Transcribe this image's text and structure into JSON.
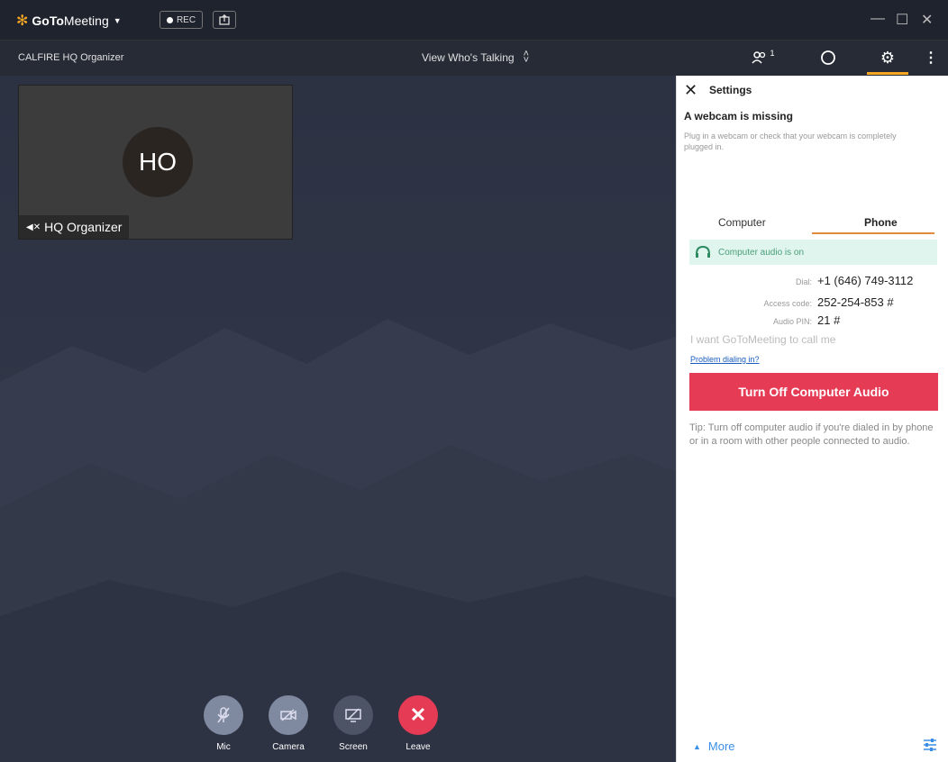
{
  "app": {
    "logo_bold": "GoTo",
    "logo_rest": "Meeting",
    "rec_label": "REC",
    "meeting_title": "CALFIRE HQ Organizer",
    "view_mode": "View Who's Talking",
    "attendee_count": "1"
  },
  "tile": {
    "initials": "HO",
    "name": "HQ Organizer"
  },
  "controls": [
    {
      "label": "Mic"
    },
    {
      "label": "Camera"
    },
    {
      "label": "Screen"
    },
    {
      "label": "Leave"
    }
  ],
  "panel": {
    "title": "Settings",
    "warning_title": "A webcam is missing",
    "warning_msg": "Plug in a webcam or check that your webcam is completely plugged in.",
    "tabs": [
      {
        "label": "Computer",
        "active": false
      },
      {
        "label": "Phone",
        "active": true
      }
    ],
    "audio_status": "Computer audio is on",
    "dial_label": "Dial:",
    "dial_value": "+1 (646) 749-3112",
    "access_label": "Access code:",
    "access_value": "252-254-853 #",
    "pin_label": "Audio PIN:",
    "pin_value": "21 #",
    "call_me": "I want GoToMeeting to call me",
    "problem_link": "Problem dialing in?",
    "turn_off_button": "Turn Off Computer Audio",
    "tip": "Tip: Turn off computer audio if you're dialed in by phone or in a room with other people connected to audio.",
    "more_label": "More"
  },
  "colors": {
    "accent_orange": "#f5a623",
    "leave_red": "#e63b55",
    "link_blue": "#3a8ee6",
    "audio_green": "#4a9e7a"
  }
}
